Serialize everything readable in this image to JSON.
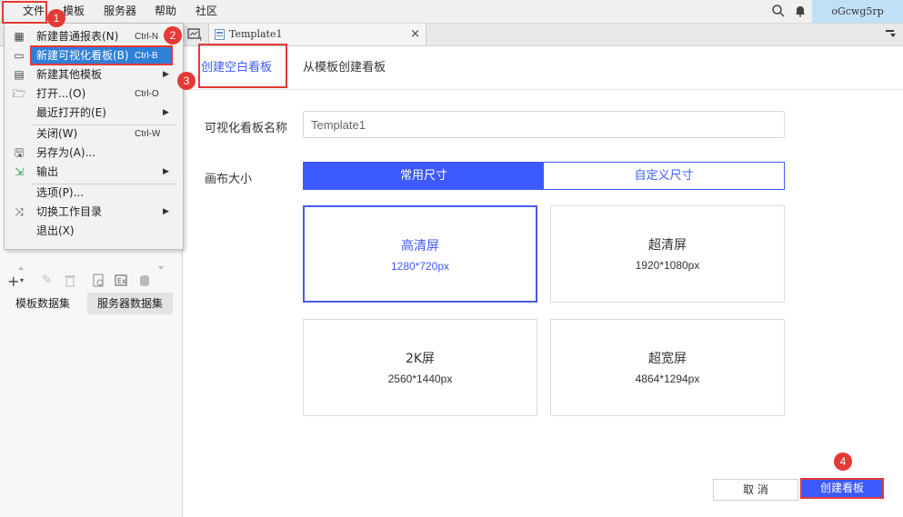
{
  "menubar": {
    "items": [
      "文件",
      "模板",
      "服务器",
      "帮助",
      "社区"
    ],
    "user": "oGcwg5rp"
  },
  "tab": {
    "title": "Template1",
    "close": "×"
  },
  "file_menu": {
    "items": [
      {
        "icon": "grid-report-icon",
        "label": "新建普通报表(N)",
        "shortcut": "Ctrl-N"
      },
      {
        "icon": "dashboard-icon",
        "label": "新建可视化看板(B)",
        "shortcut": "Ctrl-B",
        "highlighted": true
      },
      {
        "icon": "template-icon",
        "label": "新建其他模板",
        "submenu": true
      },
      {
        "icon": "folder-open-icon",
        "label": "打开...(O)",
        "shortcut": "Ctrl-O"
      },
      {
        "icon": "",
        "label": "最近打开的(E)",
        "submenu": true
      },
      {
        "icon": "",
        "label": "关闭(W)",
        "shortcut": "Ctrl-W"
      },
      {
        "icon": "save-as-icon",
        "label": "另存为(A)..."
      },
      {
        "icon": "export-icon",
        "label": "输出",
        "submenu": true
      },
      {
        "icon": "",
        "label": "选项(P)..."
      },
      {
        "icon": "switch-icon",
        "label": "切换工作目录",
        "submenu": true
      },
      {
        "icon": "",
        "label": "退出(X)"
      }
    ]
  },
  "left_panel": {
    "dataset_tabs": [
      "模板数据集",
      "服务器数据集"
    ]
  },
  "dialog": {
    "tabs": [
      "创建空白看板",
      "从模板创建看板"
    ],
    "name_label": "可视化看板名称",
    "name_value": "Template1",
    "canvas_label": "画布大小",
    "size_modes": [
      "常用尺寸",
      "自定义尺寸"
    ],
    "presets": [
      {
        "name": "高清屏",
        "size": "1280*720px"
      },
      {
        "name": "超清屏",
        "size": "1920*1080px"
      },
      {
        "name": "2K屏",
        "size": "2560*1440px"
      },
      {
        "name": "超宽屏",
        "size": "4864*1294px"
      }
    ],
    "cancel": "取 消",
    "create": "创建看板"
  },
  "annotations": [
    "1",
    "2",
    "3",
    "4"
  ],
  "colors": {
    "accent": "#3d5afe",
    "annotation_red": "#e53935",
    "highlight": "#2e7fd9"
  }
}
